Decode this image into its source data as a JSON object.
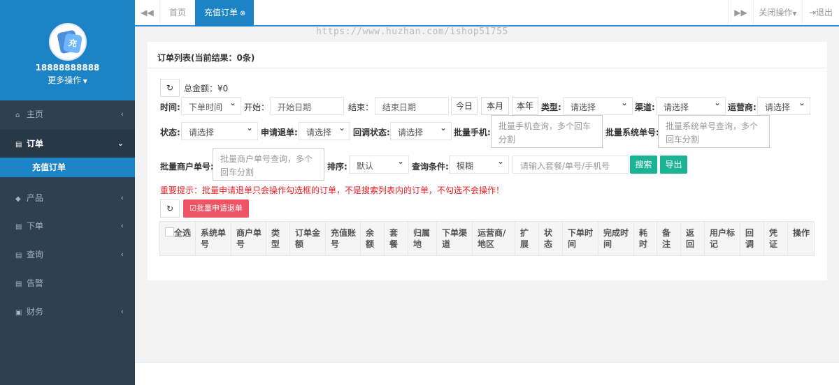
{
  "sidebar": {
    "user": "18888888888",
    "more": "更多操作",
    "avatar_glyph": "充",
    "items": [
      {
        "icon": "home-icon",
        "label": "主页"
      },
      {
        "icon": "file-icon",
        "label": "订单"
      },
      {
        "icon": "cube-icon",
        "label": "产品"
      },
      {
        "icon": "file-icon",
        "label": "下单"
      },
      {
        "icon": "file-icon",
        "label": "查询"
      },
      {
        "icon": "file-icon",
        "label": "告警"
      },
      {
        "icon": "money-icon",
        "label": "财务"
      }
    ],
    "sub_item": "充值订单"
  },
  "topbar": {
    "home_tab": "首页",
    "active_tab": "充值订单",
    "close_ops": "关闭操作",
    "logout": "退出"
  },
  "watermark": "https://www.huzhan.com/ishop51755",
  "panel": {
    "title": "订单列表(当前结果：0条)",
    "total": "总金额：¥0",
    "time_label": "时间:",
    "time_value": "下单时间",
    "start_label": "开始：",
    "start_ph": "开始日期",
    "end_label": "结束：",
    "end_ph": "结束日期",
    "today": "今日",
    "month": "本月",
    "year": "本年",
    "type_label": "类型:",
    "type_value": "请选择",
    "channel_label": "渠道:",
    "channel_value": "请选择",
    "operator_label": "运营商:",
    "operator_value": "请选择",
    "status_label": "状态:",
    "status_value": "请选择",
    "refund_label": "申请退单:",
    "refund_value": "请选择",
    "callback_label": "回调状态:",
    "callback_value": "请选择",
    "phone_label": "批量手机:",
    "phone_ph": "批量手机查询，多个回车分割",
    "sysno_label": "批量系统单号:",
    "sysno_ph": "批量系统单号查询，多个回车分割",
    "merno_label": "批量商户单号:",
    "merno_ph": "批量商户单号查询，多个回车分割",
    "sort_label": "排序:",
    "sort_value": "默认",
    "cond_label": "查询条件:",
    "cond_value": "模糊",
    "search_ph": "请输入套餐/单号/手机号",
    "search_btn": "搜索",
    "export_btn": "导出",
    "warning": "重要提示：批量申请退单只会操作勾选框的订单，不是搜索列表内的订单，不勾选不会操作！",
    "batch_btn": "批量申请退单"
  },
  "table": {
    "columns": [
      "全选",
      "系统单号",
      "商户单号",
      "类型",
      "订单金额",
      "充值账号",
      "余额",
      "套餐",
      "归属地",
      "下单渠道",
      "运营商/地区",
      "扩展",
      "状态",
      "下单时间",
      "完成时间",
      "耗时",
      "备注",
      "返回",
      "用户标记",
      "回调",
      "凭证",
      "操作"
    ]
  }
}
